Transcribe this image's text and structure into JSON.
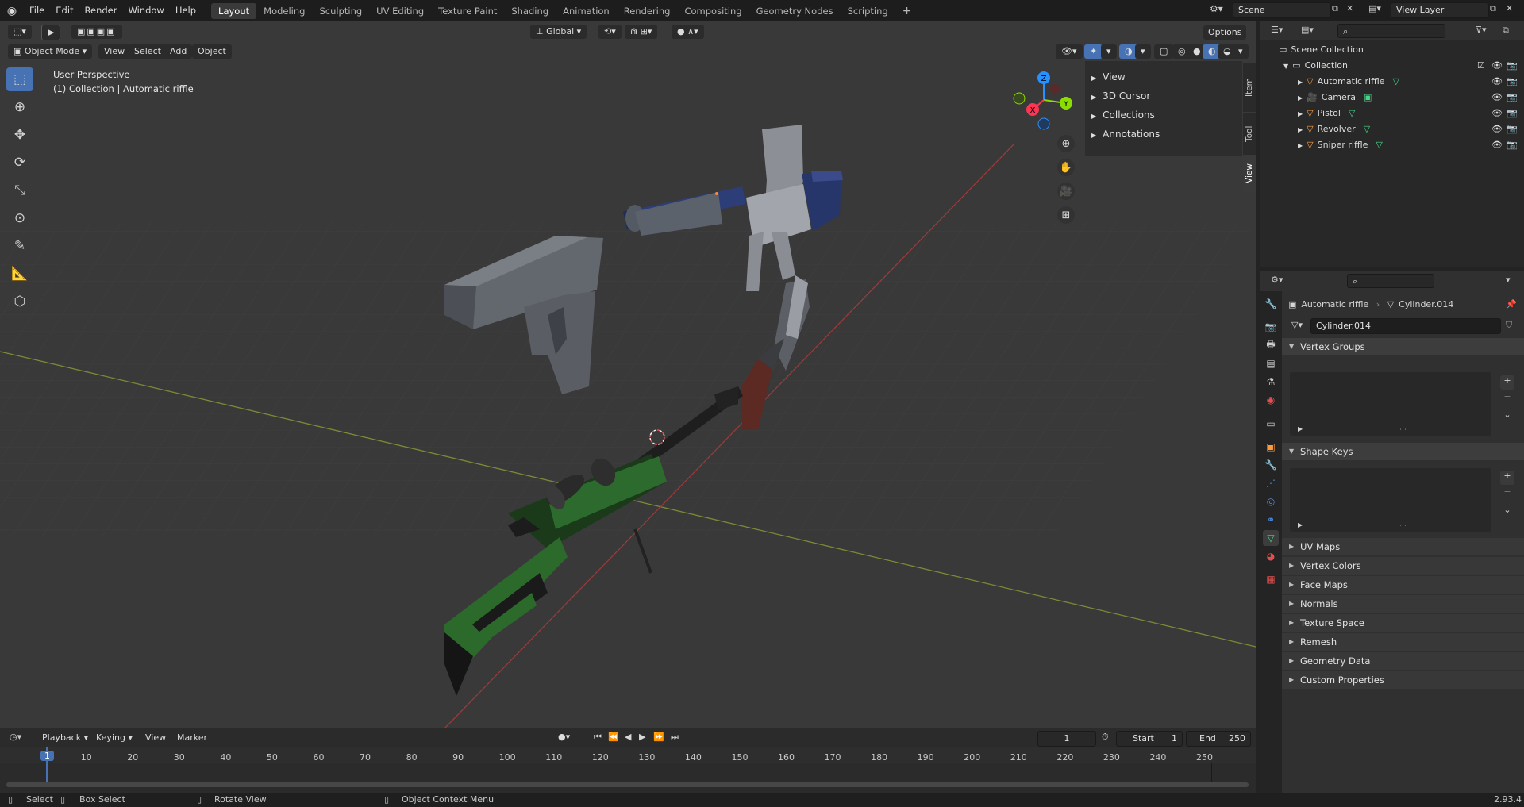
{
  "topbar": {
    "menus": [
      "File",
      "Edit",
      "Render",
      "Window",
      "Help"
    ],
    "workspaces": [
      "Layout",
      "Modeling",
      "Sculpting",
      "UV Editing",
      "Texture Paint",
      "Shading",
      "Animation",
      "Rendering",
      "Compositing",
      "Geometry Nodes",
      "Scripting"
    ],
    "active_workspace": "Layout",
    "scene": "Scene",
    "view_layer": "View Layer"
  },
  "viewport": {
    "mode": "Object Mode",
    "menus": [
      "View",
      "Select",
      "Add",
      "Object"
    ],
    "orientation": "Global",
    "options": "Options",
    "overlay_title": "User Perspective",
    "overlay_sub": "(1) Collection | Automatic riffle",
    "gizmo_axes": [
      "Z",
      "Y",
      "X"
    ],
    "n_panel": [
      "View",
      "3D Cursor",
      "Collections",
      "Annotations"
    ],
    "side_tabs": [
      "Item",
      "Tool",
      "View"
    ]
  },
  "outliner": {
    "root": "Scene Collection",
    "collection": "Collection",
    "items": [
      "Automatic riffle",
      "Camera",
      "Pistol",
      "Revolver",
      "Sniper riffle"
    ]
  },
  "properties": {
    "object": "Automatic riffle",
    "mesh": "Cylinder.014",
    "datablock": "Cylinder.014",
    "panels_open": [
      "Vertex Groups",
      "Shape Keys"
    ],
    "panels_closed": [
      "UV Maps",
      "Vertex Colors",
      "Face Maps",
      "Normals",
      "Texture Space",
      "Remesh",
      "Geometry Data",
      "Custom Properties"
    ]
  },
  "timeline": {
    "menus": [
      "Playback",
      "Keying",
      "View",
      "Marker"
    ],
    "current_frame": "1",
    "start_label": "Start",
    "start": "1",
    "end_label": "End",
    "end": "250",
    "ticks": [
      "1",
      "10",
      "20",
      "30",
      "40",
      "50",
      "60",
      "70",
      "80",
      "90",
      "100",
      "110",
      "120",
      "130",
      "140",
      "150",
      "160",
      "170",
      "180",
      "190",
      "200",
      "210",
      "220",
      "230",
      "240",
      "250"
    ]
  },
  "status": {
    "select": "Select",
    "box_select": "Box Select",
    "rotate": "Rotate View",
    "context": "Object Context Menu",
    "version": "2.93.4"
  },
  "colors": {
    "accent": "#4772b3",
    "x_axis": "#ff3352",
    "y_axis": "#8bdc00",
    "z_axis": "#2890ff"
  }
}
